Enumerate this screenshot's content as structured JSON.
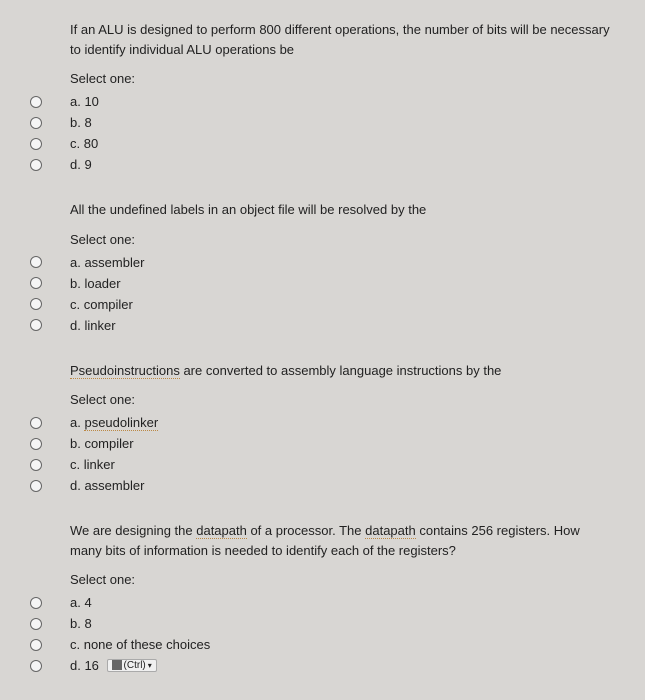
{
  "questions": [
    {
      "text": "If an ALU is designed to perform 800 different operations, the number of bits will be necessary to identify individual ALU operations be",
      "select_label": "Select one:",
      "options": [
        {
          "label": "a. 10"
        },
        {
          "label": "b. 8"
        },
        {
          "label": "c. 80"
        },
        {
          "label": "d. 9"
        }
      ]
    },
    {
      "text": "All the undefined labels in an object file will be resolved by the",
      "select_label": "Select one:",
      "options": [
        {
          "label": "a. assembler"
        },
        {
          "label": "b. loader"
        },
        {
          "label": "c. compiler"
        },
        {
          "label": "d. linker"
        }
      ]
    },
    {
      "text_parts": {
        "underlined": "Pseudoinstructions",
        "rest": " are converted to assembly language instructions by the"
      },
      "select_label": "Select one:",
      "options": [
        {
          "label_prefix": "a. ",
          "underlined": "pseudolinker"
        },
        {
          "label": "b. compiler"
        },
        {
          "label": "c. linker"
        },
        {
          "label": "d. assembler"
        }
      ]
    },
    {
      "text_parts": {
        "p1": "We are designing the ",
        "u1": "datapath",
        "p2": " of a processor. The ",
        "u2": "datapath",
        "p3": " contains 256 registers. How many bits of information is needed to identify each of the registers?"
      },
      "select_label": "Select one:",
      "options": [
        {
          "label": "a. 4"
        },
        {
          "label": "b. 8"
        },
        {
          "label": "c. none of these choices"
        },
        {
          "label": "d. 16",
          "ctrl": "(Ctrl)"
        }
      ]
    }
  ]
}
